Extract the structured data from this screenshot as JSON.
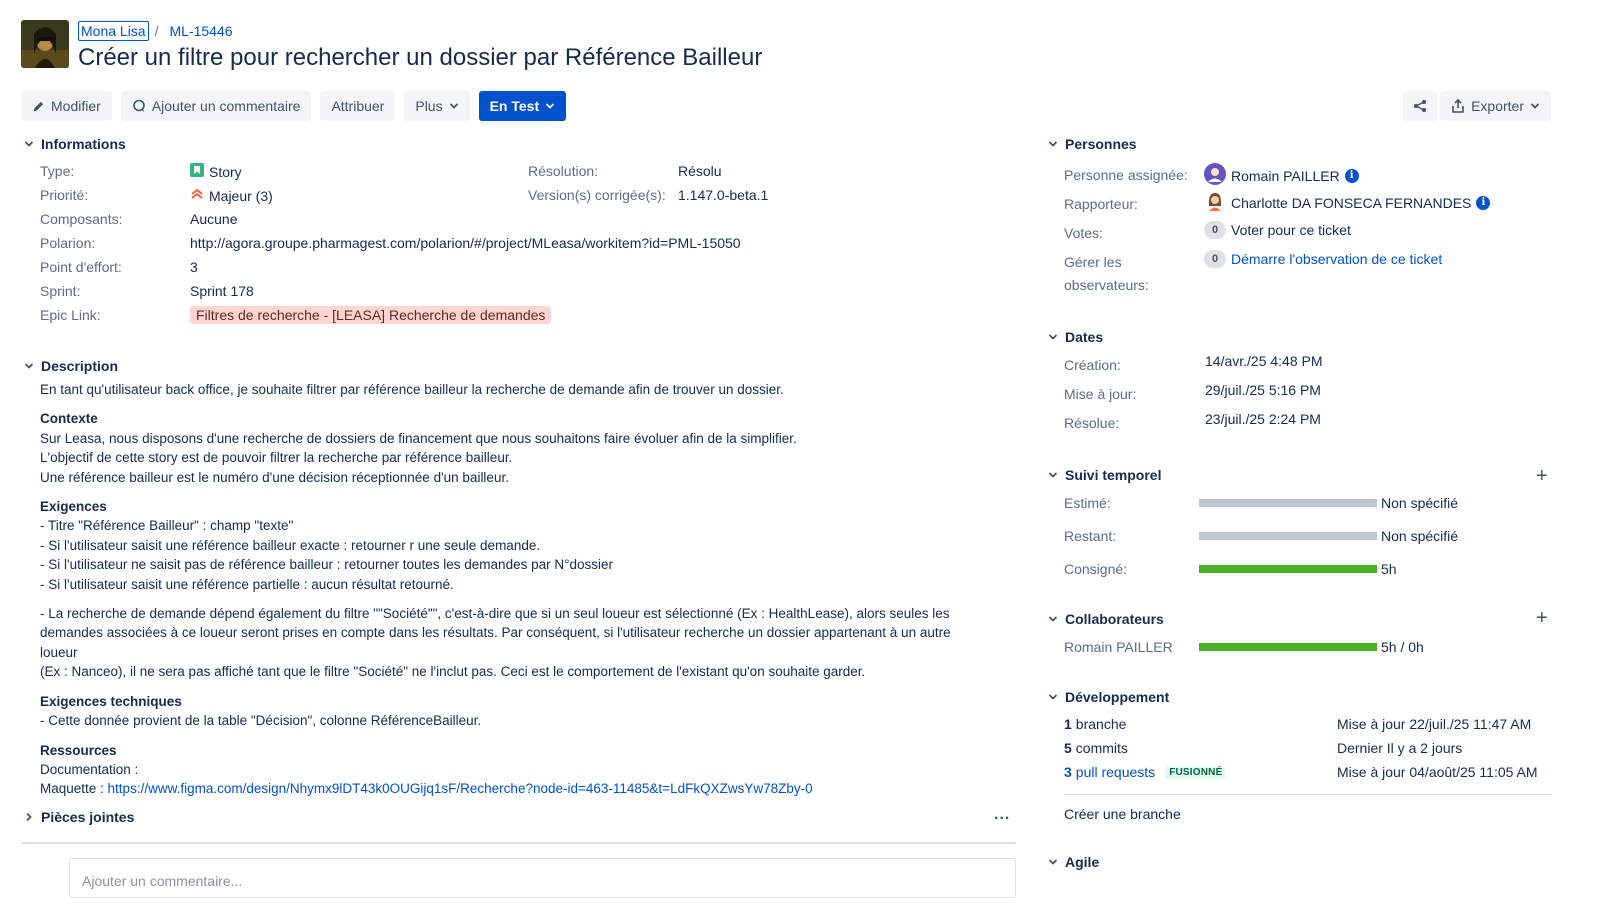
{
  "header": {
    "project_name": "Mona Lisa",
    "issue_key": "ML-15446",
    "separator": "/",
    "title": "Créer un filtre pour rechercher un dossier par Référence Bailleur"
  },
  "toolbar": {
    "edit": "Modifier",
    "comment": "Ajouter un commentaire",
    "assign": "Attribuer",
    "more": "Plus",
    "status": "En Test",
    "export": "Exporter"
  },
  "informations": {
    "title": "Informations",
    "type_label": "Type:",
    "type_value": "Story",
    "priority_label": "Priorité:",
    "priority_value": "Majeur (3)",
    "components_label": "Composants:",
    "components_value": "Aucune",
    "polarion_label": "Polarion:",
    "polarion_value": "http://agora.groupe.pharmagest.com/polarion/#/project/MLeasa/workitem?id=PML-15050",
    "effort_label": "Point d'effort:",
    "effort_value": "3",
    "sprint_label": "Sprint:",
    "sprint_value": "Sprint 178",
    "epic_label": "Epic Link:",
    "epic_value": "Filtres de recherche - [LEASA] Recherche de demandes",
    "resolution_label": "Résolution:",
    "resolution_value": "Résolu",
    "fix_version_label": "Version(s) corrigée(s):",
    "fix_version_value": "1.147.0-beta.1"
  },
  "description": {
    "title": "Description",
    "intro": "En tant qu'utilisateur back office, je souhaite filtrer par référence bailleur la recherche de demande afin de trouver un dossier.",
    "context_title": "Contexte",
    "context_lines": [
      "Sur Leasa, nous disposons d'une recherche de dossiers de financement que nous souhaitons faire évoluer afin de la simplifier.",
      "L'objectif de cette story est de pouvoir filtrer la recherche par référence bailleur.",
      "Une référence bailleur est le numéro d'une décision réceptionnée d'un bailleur."
    ],
    "req_title": "Exigences",
    "req_lines": [
      "- Titre \"Référence Bailleur\" : champ \"texte\"",
      "- Si l'utilisateur saisit une référence bailleur exacte : retourner r une seule demande.",
      "- Si l'utilisateur ne saisit pas de référence bailleur : retourner toutes les demandes par N°dossier",
      "- Si l'utilisateur saisit une référence partielle : aucun résultat retourné."
    ],
    "req_paragraph": [
      "- La recherche de demande dépend également du filtre \"\"Société\"\", c'est-à-dire que si un seul loueur est sélectionné (Ex : HealthLease), alors seules les",
      "demandes associées à ce loueur seront prises en compte dans les résultats. Par conséquent, si l'utilisateur recherche un dossier appartenant à un autre loueur",
      "(Ex : Nanceo), il ne sera pas affiché tant que le filtre \"Société\" ne l'inclut pas. Ceci est le comportement de l'existant qu'on souhaite garder."
    ],
    "tech_title": "Exigences techniques",
    "tech_line": "- Cette donnée provient de la table \"Décision\", colonne RéférenceBailleur.",
    "res_title": "Ressources",
    "res_doc": "Documentation :",
    "res_maquette_label": "Maquette : ",
    "res_maquette_link": "https://www.figma.com/design/Nhymx9lDT43k0OUGijq1sF/Recherche?node-id=463-11485&t=LdFkQXZwsYw78Zby-0"
  },
  "attachments": {
    "title": "Pièces jointes",
    "more": "..."
  },
  "people": {
    "title": "Personnes",
    "assignee_label": "Personne assignée:",
    "assignee": "Romain PAILLER",
    "reporter_label": "Rapporteur:",
    "reporter": "Charlotte DA FONSECA FERNANDES",
    "votes_label": "Votes:",
    "votes_count": "0",
    "votes_link": "Voter pour ce ticket",
    "watchers_label_1": "Gérer les",
    "watchers_label_2": "observateurs:",
    "watchers_count": "0",
    "watchers_link": "Démarre l'observation de ce ticket"
  },
  "dates": {
    "title": "Dates",
    "created_label": "Création:",
    "created": "14/avr./25 4:48 PM",
    "updated_label": "Mise à jour:",
    "updated": "29/juil./25 5:16 PM",
    "resolved_label": "Résolue:",
    "resolved": "23/juil./25 2:24 PM"
  },
  "time_tracking": {
    "title": "Suivi temporel",
    "estimated_label": "Estimé:",
    "estimated": "Non spécifié",
    "remaining_label": "Restant:",
    "remaining": "Non spécifié",
    "logged_label": "Consigné:",
    "logged": "5h",
    "estimated_fill": 1.0,
    "remaining_fill": 1.0,
    "logged_fill": 1.0
  },
  "collaborators": {
    "title": "Collaborateurs",
    "name": "Romain PAILLER",
    "value": "5h / 0h",
    "fill": 1.0
  },
  "development": {
    "title": "Développement",
    "branch_count": "1",
    "branch_label": "branche",
    "branch_meta": "Mise à jour 22/juil./25 11:47 AM",
    "commits_count": "5",
    "commits_label": "commits",
    "commits_meta": "Dernier Il y a 2 jours",
    "pr_count": "3",
    "pr_label": "pull requests",
    "pr_status": "FUSIONNÉ",
    "pr_meta": "Mise à jour 04/août/25 11:05 AM",
    "create_branch": "Créer une branche"
  },
  "agile": {
    "title": "Agile"
  },
  "comment": {
    "placeholder": "Ajouter un commentaire..."
  },
  "colors": {
    "primary": "#0052cc",
    "green": "#4caf2a",
    "grey_bar": "#c1c7d0",
    "epic_bg": "#ffd5d2"
  }
}
